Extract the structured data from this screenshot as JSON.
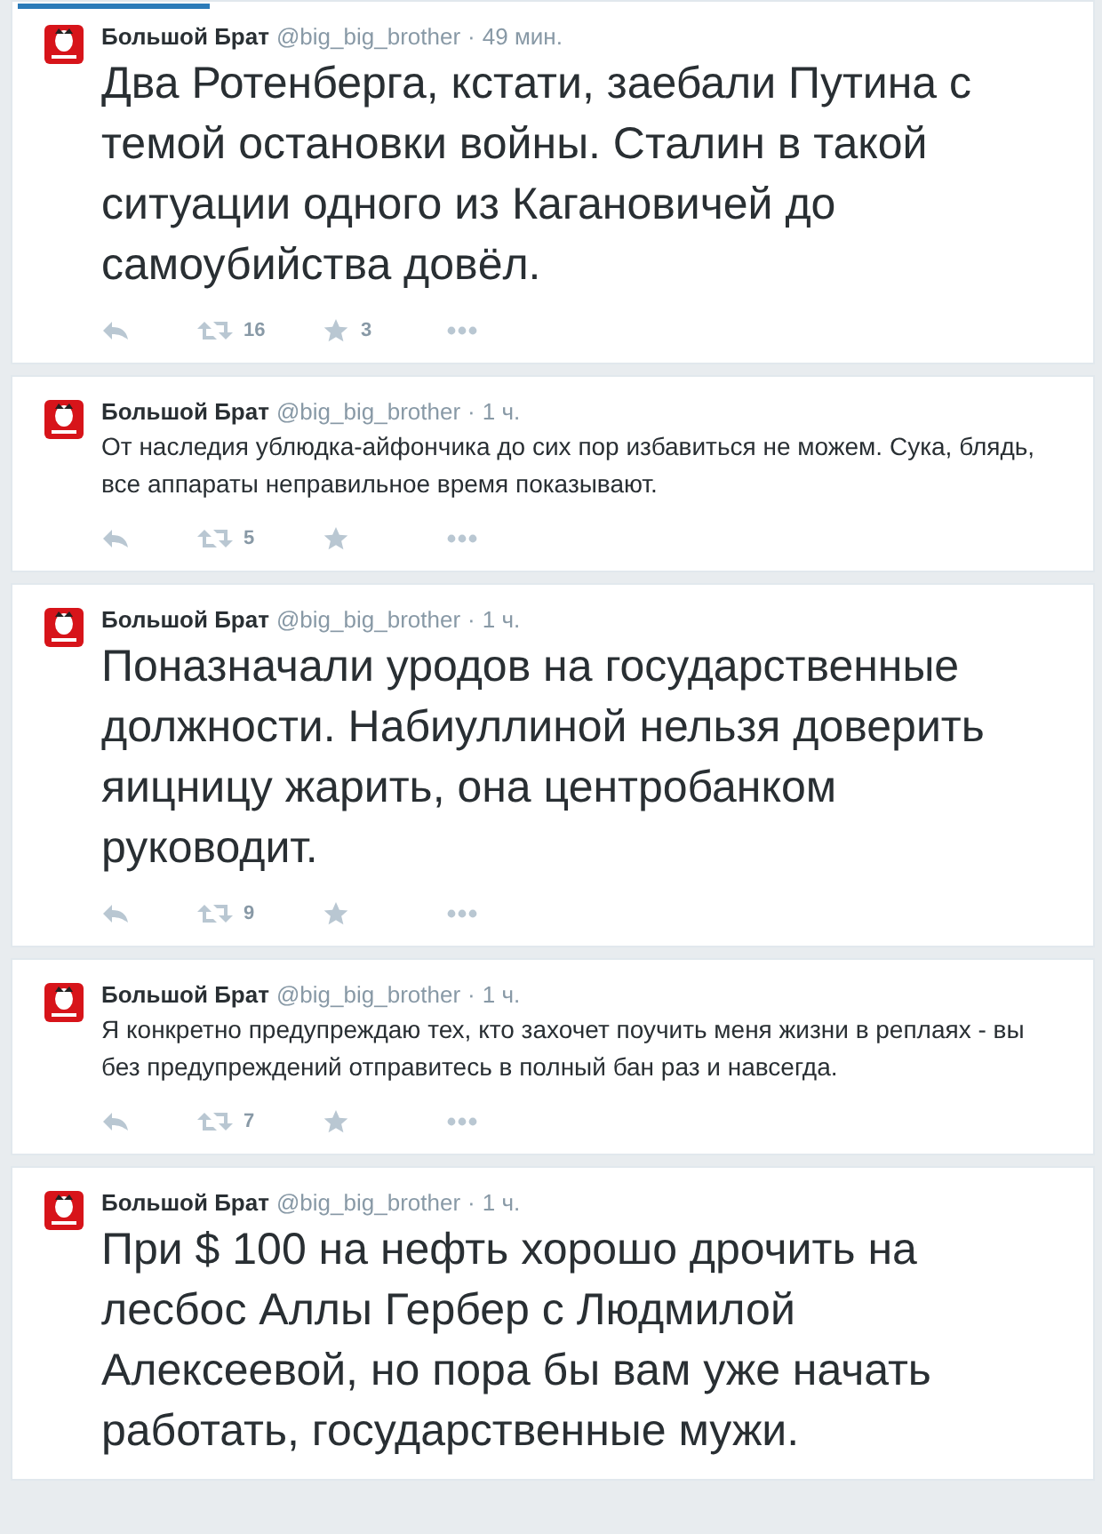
{
  "separator": "·",
  "tweets": [
    {
      "kind": "large",
      "name": "Большой Брат",
      "handle": "@big_big_brother",
      "time": "49 мин.",
      "text": "Два Ротенберга, кстати, заебали Путина с темой остановки войны. Сталин в такой ситуации одного из Кагановичей до самоубийства довёл.",
      "retweets": "16",
      "favorites": "3"
    },
    {
      "kind": "small",
      "name": "Большой Брат",
      "handle": "@big_big_brother",
      "time": "1 ч.",
      "text": "От наследия ублюдка-айфончика до сих пор избавиться не можем. Сука, блядь, все аппараты неправильное время показывают.",
      "retweets": "5"
    },
    {
      "kind": "large",
      "name": "Большой Брат",
      "handle": "@big_big_brother",
      "time": "1 ч.",
      "text": "Поназначали уродов на государственные должности. Набиуллиной нельзя доверить яицницу жарить, она центробанком руководит.",
      "retweets": "9"
    },
    {
      "kind": "small",
      "name": "Большой Брат",
      "handle": "@big_big_brother",
      "time": "1 ч.",
      "text": "Я конкретно предупреждаю тех, кто захочет поучить меня жизни в реплаях - вы без предупреждений отправитесь в полный бан раз и навсегда.",
      "retweets": "7"
    },
    {
      "kind": "large",
      "name": "Большой Брат",
      "handle": "@big_big_brother",
      "time": "1 ч.",
      "text": "При $ 100 на нефть хорошо дрочить на лесбос Аллы Гербер с Людмилой Алексеевой, но пора бы вам уже начать работать, государственные мужи."
    }
  ]
}
